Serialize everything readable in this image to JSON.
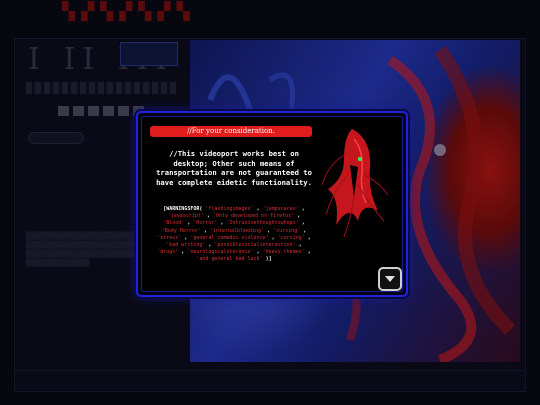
{
  "dialog": {
    "header": "//For your consideration.",
    "notice": "//This videoport works best on desktop; Other such means of transportation are not guaranteed to have complete eidetic functionality.",
    "warnings_prefix": "[WARNINGSFOR(",
    "warnings": [
      "flashingimages",
      "jumpscares",
      "javascript",
      "Only developed on firefox",
      "Blood",
      "Horror",
      "Intrusivethoughtswhops",
      "Body Horror",
      "internalbleeding",
      "cursing",
      "stress",
      "general comedic violence",
      "cursing",
      "bad writing",
      "possiblesocialinteraction",
      "drugs",
      "neurologicalsteranis",
      "heavy themes",
      "and general bad luck"
    ],
    "warnings_suffix": ")]"
  },
  "icons": {
    "next": "chevron-down-icon",
    "figure": "red-specter-figure"
  },
  "colors": {
    "accent_red": "#e01c1c",
    "frame_blue": "#2222d8",
    "background": "#07070f"
  }
}
